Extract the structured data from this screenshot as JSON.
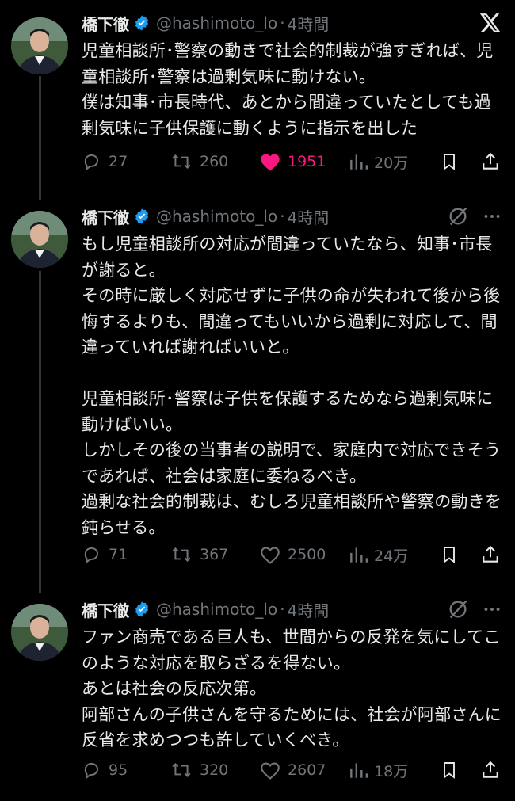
{
  "tweets": [
    {
      "name": "橋下徹",
      "handle": "@hashimoto_lo",
      "separator": "·",
      "time": "4時間",
      "text": "児童相談所･警察の動きで社会的制裁が強すぎれば、児童相談所･警察は過剰気味に動けない。\n僕は知事･市長時代、あとから間違っていたとしても過剰気味に子供保護に動くように指示を出した",
      "replies": "27",
      "retweets": "260",
      "likes": "1951",
      "views": "20万",
      "liked": true,
      "header_icon": "x-logo-icon"
    },
    {
      "name": "橋下徹",
      "handle": "@hashimoto_lo",
      "separator": "·",
      "time": "4時間",
      "text": "もし児童相談所の対応が間違っていたなら、知事･市長が謝ると。\nその時に厳しく対応せずに子供の命が失われて後から後悔するよりも、間違ってもいいから過剰に対応して、間違っていれば謝ればいいと。\n\n児童相談所･警察は子供を保護するためなら過剰気味に動けばいい。\nしかしその後の当事者の説明で、家庭内で対応できそうであれば、社会は家庭に委ねるべき。\n過剰な社会的制裁は、むしろ児童相談所や警察の動きを鈍らせる。",
      "replies": "71",
      "retweets": "367",
      "likes": "2500",
      "views": "24万",
      "liked": false,
      "header_icon": "grok-icon"
    },
    {
      "name": "橋下徹",
      "handle": "@hashimoto_lo",
      "separator": "·",
      "time": "4時間",
      "text": "ファン商売である巨人も、世間からの反発を気にしてこのような対応を取らざるを得ない。\nあとは社会の反応次第。\n阿部さんの子供さんを守るためには、社会が阿部さんに反省を求めつつも許していくべき。",
      "replies": "95",
      "retweets": "320",
      "likes": "2607",
      "views": "18万",
      "liked": false,
      "header_icon": "grok-icon"
    }
  ],
  "colors": {
    "background": "#000000",
    "text": "#e7e9ea",
    "muted": "#71767b",
    "like": "#f91880",
    "verified": "#1d9bf0"
  }
}
